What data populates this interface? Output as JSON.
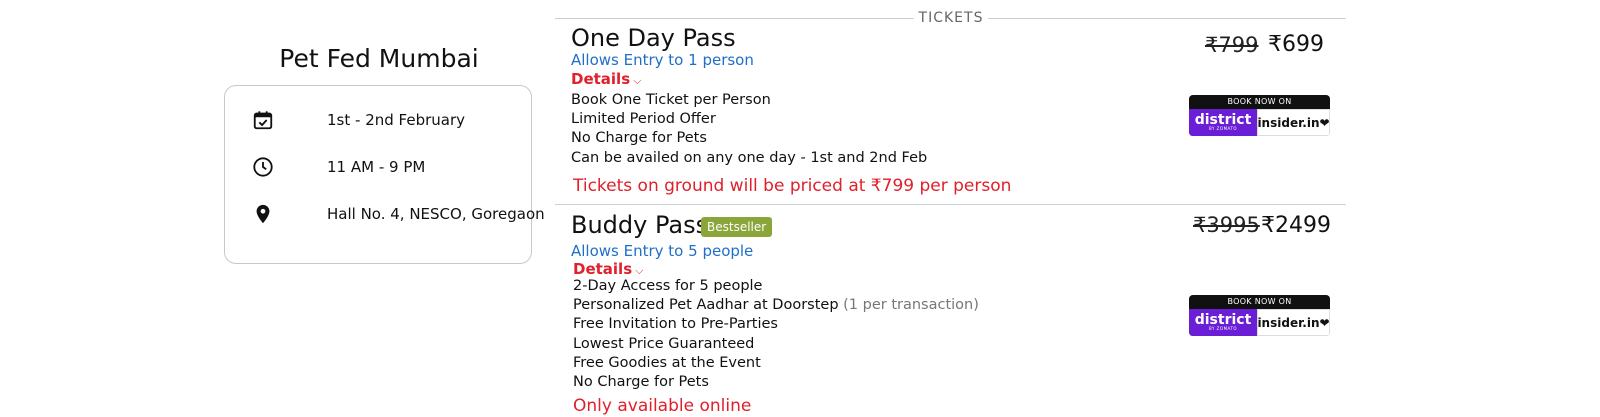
{
  "event": {
    "title": "Pet Fed Mumbai",
    "date": "1st - 2nd February",
    "time": "11 AM - 9 PM",
    "location": "Hall No. 4, NESCO, Goregaon",
    "icons": [
      "calendar-check-icon",
      "clock-icon",
      "map-pin-icon"
    ]
  },
  "tickets_label": "TICKETS",
  "tickets": [
    {
      "name": "One Day Pass",
      "allows": "Allows Entry to 1 person",
      "details_label": "Details",
      "features": [
        "Book One Ticket per Person",
        "Limited Period Offer",
        "No Charge for Pets",
        "Can be availed on any one day - 1st and 2nd Feb"
      ],
      "warning": "Tickets on ground will be priced at ₹799 per person",
      "price_old": "₹799",
      "price_new": "₹699",
      "book": {
        "top": "BOOK NOW ON",
        "district": "district",
        "district_sub": "BY ZOMATO",
        "insider": "insider.in"
      }
    },
    {
      "name": "Buddy Pass",
      "badge": "Bestseller",
      "allows": "Allows Entry to 5 people",
      "details_label": "Details",
      "features": [
        "2-Day Access for 5 people",
        "Personalized Pet Aadhar at Doorstep",
        "Free Invitation to Pre-Parties",
        "Lowest Price Guaranteed",
        "Free Goodies at the Event",
        "No Charge for Pets"
      ],
      "feature_note": "(1 per transaction)",
      "warning": "Only available online",
      "price_old": "₹3995",
      "price_new": "₹2499",
      "book": {
        "top": "BOOK NOW ON",
        "district": "district",
        "district_sub": "BY ZOMATO",
        "insider": "insider.in"
      }
    }
  ],
  "colors": {
    "link_blue": "#1f6fc9",
    "alert_red": "#e0202a",
    "badge_green": "#8aa63b",
    "district_purple": "#6a1fd6"
  }
}
